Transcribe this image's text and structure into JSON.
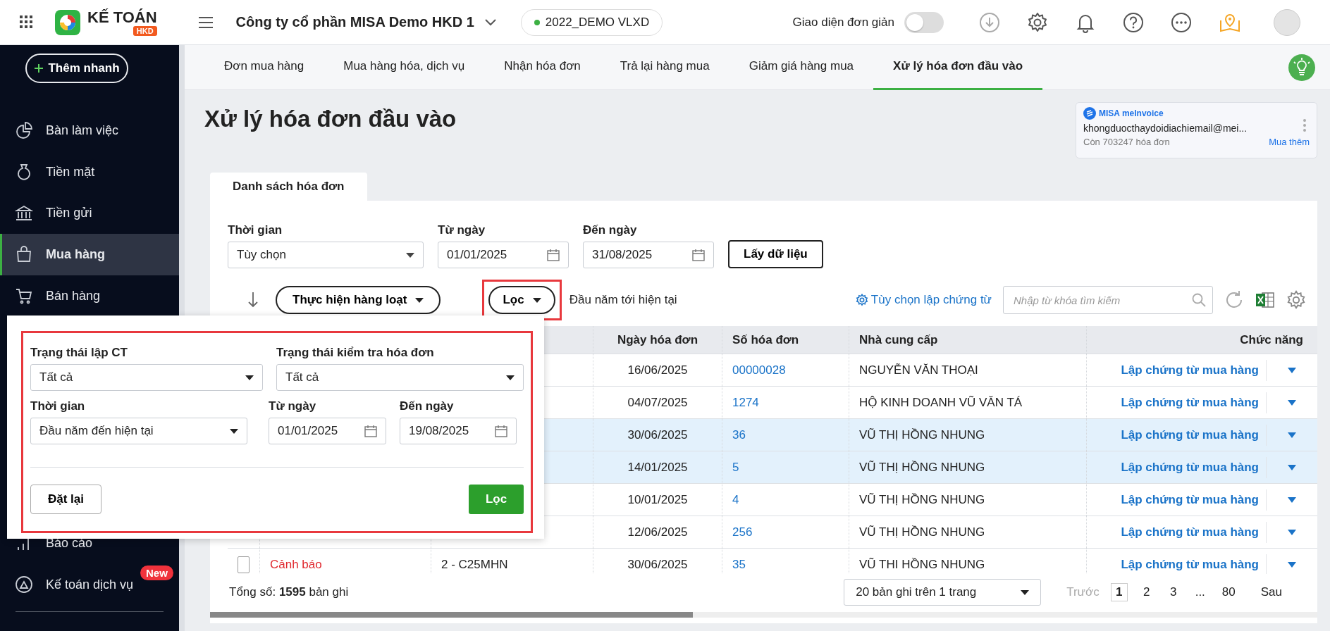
{
  "top_bar": {
    "app_name": "KẾ TOÁN",
    "app_badge": "HKD",
    "company": "Công ty cổ phần MISA Demo HKD 1",
    "database": "2022_DEMO VLXD",
    "simple_mode": {
      "label": "Giao diện đơn giản",
      "on": false
    }
  },
  "sidebar": {
    "quick_add": "Thêm nhanh",
    "items": [
      {
        "label": "Bàn làm việc",
        "selected": false
      },
      {
        "label": "Tiền mặt",
        "selected": false
      },
      {
        "label": "Tiền gửi",
        "selected": false
      },
      {
        "label": "Mua hàng",
        "selected": true
      },
      {
        "label": "Bán hàng",
        "selected": false
      },
      {
        "label": "Báo cáo",
        "selected": false
      },
      {
        "label": "Kế toán dịch vụ",
        "selected": false,
        "badge": "New"
      }
    ]
  },
  "tabs": [
    {
      "label": "Đơn mua hàng",
      "selected": false
    },
    {
      "label": "Mua hàng hóa, dịch vụ",
      "selected": false
    },
    {
      "label": "Nhận hóa đơn",
      "selected": false
    },
    {
      "label": "Trả lại hàng mua",
      "selected": false
    },
    {
      "label": "Giảm giá hàng mua",
      "selected": false
    },
    {
      "label": "Xử lý hóa đơn đầu vào",
      "selected": true
    }
  ],
  "page_title": "Xử lý hóa đơn đầu vào",
  "invoice_widget": {
    "brand": "MISA meInvoice",
    "email": "khongduocthaydoidiachiemail@mei...",
    "remaining": "Còn 703247 hóa đơn",
    "buy_more": "Mua thêm"
  },
  "card_tab": "Danh sách hóa đơn",
  "filter_form": {
    "period": {
      "label": "Thời gian",
      "value": "Tùy chọn"
    },
    "from": {
      "label": "Từ ngày",
      "value": "01/01/2025"
    },
    "to": {
      "label": "Đến ngày",
      "value": "31/08/2025"
    },
    "fetch_button": "Lấy dữ liệu"
  },
  "toolbar": {
    "bulk_button": "Thực hiện hàng loạt",
    "filter_button": "Lọc",
    "filter_summary": "Đầu năm tới hiện tại",
    "options_link": "Tùy chọn lập chứng từ",
    "search": {
      "placeholder": "Nhập từ khóa tìm kiếm"
    }
  },
  "table": {
    "columns": [
      "Ngày hóa đơn",
      "Số hóa đơn",
      "Nhà cung cấp",
      "Chức năng"
    ],
    "rows": [
      {
        "selected": false,
        "date": "16/06/2025",
        "number": "00000028",
        "supplier": "NGUYỄN VĂN THOẠI",
        "action": "Lập chứng từ mua hàng"
      },
      {
        "selected": false,
        "date": "04/07/2025",
        "number": "1274",
        "supplier": "HỘ KINH DOANH VŨ VĂN TÁ",
        "action": "Lập chứng từ mua hàng"
      },
      {
        "selected": true,
        "date": "30/06/2025",
        "number": "36",
        "supplier": "VŨ THỊ HỒNG NHUNG",
        "action": "Lập chứng từ mua hàng"
      },
      {
        "selected": true,
        "date": "14/01/2025",
        "number": "5",
        "supplier": "VŨ THỊ HỒNG NHUNG",
        "action": "Lập chứng từ mua hàng"
      },
      {
        "selected": false,
        "date": "10/01/2025",
        "number": "4",
        "supplier": "VŨ THỊ HỒNG NHUNG",
        "action": "Lập chứng từ mua hàng"
      },
      {
        "selected": false,
        "date": "12/06/2025",
        "number": "256",
        "supplier": "VŨ THỊ HỒNG NHUNG",
        "action": "Lập chứng từ mua hàng"
      },
      {
        "selected": false,
        "checked": false,
        "status": "Cảnh báo",
        "symbol": "2 - C25MHN",
        "date": "30/06/2025",
        "number": "35",
        "supplier": "VŨ THI HỒNG NHUNG",
        "action": "Lập chứng từ mua hàng"
      }
    ]
  },
  "footer": {
    "total": "Tổng số: **1595** bản ghi",
    "page_size": "20 bản ghi trên 1 trang",
    "prev": {
      "label": "Trước",
      "disabled": true
    },
    "pages": [
      {
        "label": "1",
        "selected": true
      },
      {
        "label": "2",
        "selected": false
      },
      {
        "label": "3",
        "selected": false
      },
      {
        "label": "...",
        "selected": false
      },
      {
        "label": "80",
        "selected": false
      }
    ],
    "next": "Sau"
  },
  "filter_popup": {
    "rows": [
      [
        {
          "kind": "select",
          "label": "Trạng thái lập CT",
          "value": "Tất cả"
        },
        {
          "kind": "select",
          "label": "Trạng thái kiểm tra hóa đơn",
          "value": "Tất cả"
        }
      ],
      [
        {
          "kind": "select",
          "label": "Thời gian",
          "value": "Đầu năm đến hiện tại"
        },
        {
          "kind": "date",
          "label": "Từ ngày",
          "value": "01/01/2025"
        },
        {
          "kind": "date",
          "label": "Đến ngày",
          "value": "19/08/2025"
        }
      ]
    ],
    "reset_button": "Đặt lại",
    "apply_button": "Lọc"
  }
}
